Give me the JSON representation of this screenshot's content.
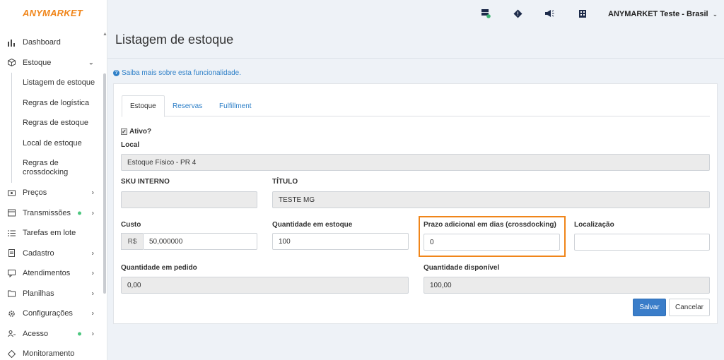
{
  "brand": {
    "logo": "ANYMARKET",
    "color": "#f08519"
  },
  "sidebar": {
    "items": [
      {
        "label": "Dashboard",
        "icon": "bar-chart-icon"
      },
      {
        "label": "Estoque",
        "icon": "box-icon",
        "expanded": true,
        "children": [
          "Listagem de estoque",
          "Regras de logística",
          "Regras de estoque",
          "Local de estoque",
          "Regras de crossdocking"
        ]
      },
      {
        "label": "Preços",
        "icon": "price-tag-icon"
      },
      {
        "label": "Transmissões",
        "icon": "transmission-icon",
        "badge": true
      },
      {
        "label": "Tarefas em lote",
        "icon": "list-icon"
      },
      {
        "label": "Cadastro",
        "icon": "document-icon"
      },
      {
        "label": "Atendimentos",
        "icon": "chat-icon"
      },
      {
        "label": "Planilhas",
        "icon": "spreadsheet-icon"
      },
      {
        "label": "Configurações",
        "icon": "gear-icon"
      },
      {
        "label": "Acesso",
        "icon": "users-icon",
        "badge": true
      },
      {
        "label": "Monitoramento",
        "icon": "diamond-icon"
      }
    ]
  },
  "topbar": {
    "account": "ANYMARKET Teste - Brasil"
  },
  "page": {
    "title": "Listagem de estoque",
    "help_link": "Saiba mais sobre esta funcionalidade."
  },
  "tabs": [
    "Estoque",
    "Reservas",
    "Fulfillment"
  ],
  "form": {
    "active_label": "Ativo?",
    "local_label": "Local",
    "local_value": "Estoque Físico - PR 4",
    "sku_label": "SKU INTERNO",
    "sku_value": "",
    "titulo_label": "TÍTULO",
    "titulo_value": "TESTE MG",
    "custo_label": "Custo",
    "custo_prefix": "R$",
    "custo_value": "50,000000",
    "qtd_estoque_label": "Quantidade em estoque",
    "qtd_estoque_value": "100",
    "prazo_label": "Prazo adicional em dias (crossdocking)",
    "prazo_value": "0",
    "localizacao_label": "Localização",
    "localizacao_value": "",
    "qtd_pedido_label": "Quantidade em pedido",
    "qtd_pedido_value": "0,00",
    "qtd_disponivel_label": "Quantidade disponível",
    "qtd_disponivel_value": "100,00"
  },
  "buttons": {
    "save": "Salvar",
    "cancel": "Cancelar"
  }
}
